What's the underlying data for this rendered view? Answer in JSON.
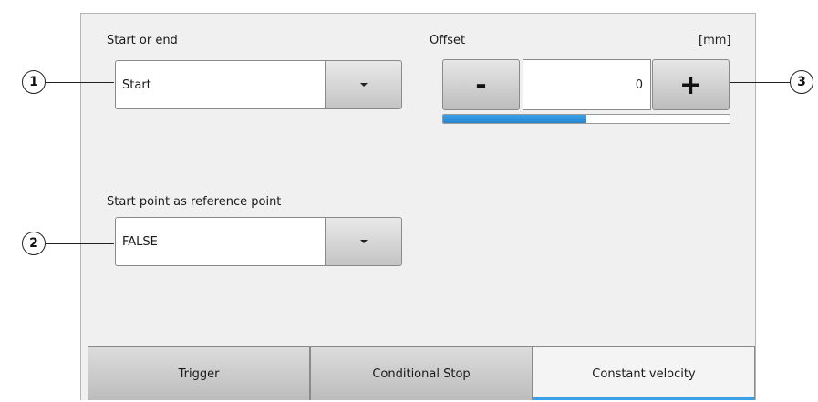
{
  "colors": {
    "accent": "#3aa0e8",
    "tab_underline": "#3aa0e8"
  },
  "start_or_end": {
    "label": "Start or end",
    "value": "Start"
  },
  "offset": {
    "label": "Offset",
    "unit": "[mm]",
    "minus_label": "-",
    "value": "0",
    "plus_label": "+",
    "progress_percent": 50
  },
  "reference_point": {
    "label": "Start point as reference point",
    "value": "FALSE"
  },
  "callouts": [
    "1",
    "2",
    "3"
  ],
  "tabs": [
    {
      "label": "Trigger",
      "active": false
    },
    {
      "label": "Conditional Stop",
      "active": false
    },
    {
      "label": "Constant velocity",
      "active": true
    }
  ]
}
